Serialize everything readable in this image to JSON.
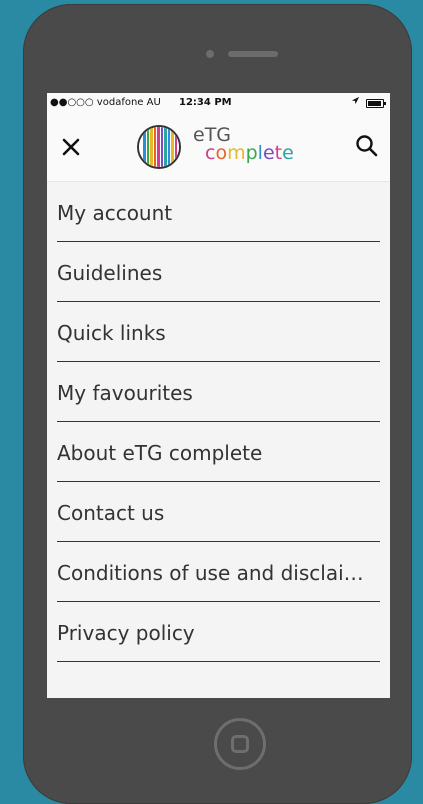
{
  "status_bar": {
    "carrier": "●●○○○ vodafone AU",
    "time": "12:34 PM"
  },
  "header": {
    "logo_line1": "eTG",
    "logo_line2_letters": [
      "c",
      "o",
      "m",
      "p",
      "l",
      "e",
      "t",
      "e"
    ],
    "logo_line2_colors": [
      "#d23c8a",
      "#e8632a",
      "#e6b82a",
      "#3aa84a",
      "#2a8fd6",
      "#7a4bc2",
      "#d23c8a",
      "#2aa5a0"
    ]
  },
  "menu": {
    "items": [
      {
        "label": "My account"
      },
      {
        "label": "Guidelines"
      },
      {
        "label": "Quick links"
      },
      {
        "label": "My favourites"
      },
      {
        "label": "About eTG complete"
      },
      {
        "label": "Contact us"
      },
      {
        "label": "Conditions of use and disclai…"
      },
      {
        "label": "Privacy policy"
      }
    ]
  },
  "colors": {
    "background": "#2a8aa3",
    "phone_body": "#4a4a4a",
    "screen": "#f4f4f4",
    "text": "#333333"
  },
  "icons": {
    "close": "close-icon",
    "search": "search-icon",
    "home": "home-button-icon"
  }
}
